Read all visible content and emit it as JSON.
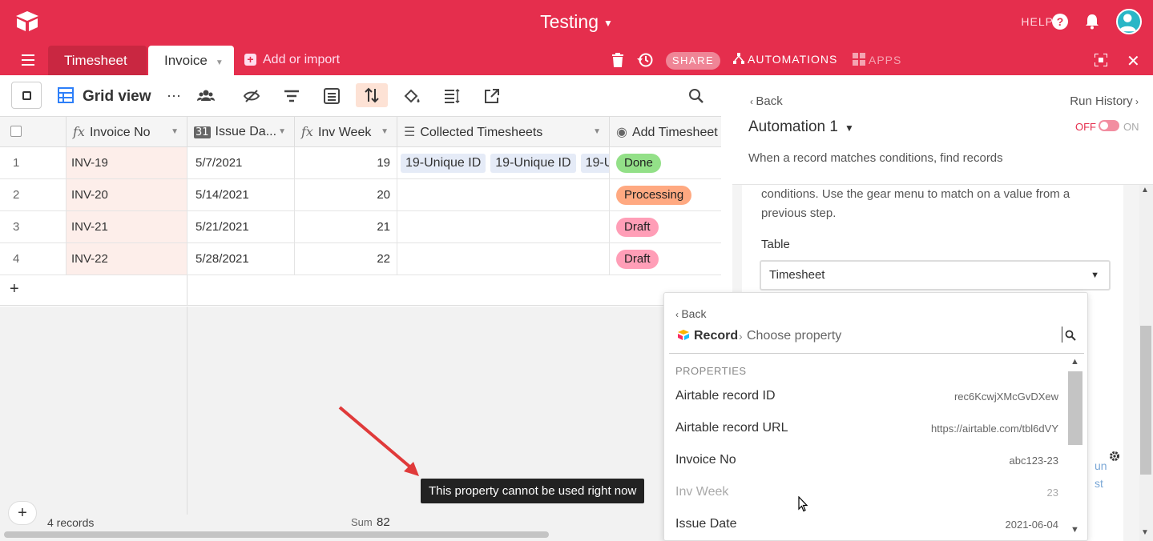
{
  "app": {
    "base_title": "Testing",
    "help_label": "HELP"
  },
  "tabs": [
    {
      "label": "Timesheet"
    },
    {
      "label": "Invoice"
    }
  ],
  "topbar": {
    "add_import": "Add or import",
    "share": "SHARE",
    "automations": "AUTOMATIONS",
    "apps": "APPS"
  },
  "toolbar": {
    "view_name": "Grid view"
  },
  "grid": {
    "columns": [
      {
        "label": "Invoice No",
        "icon": "formula-icon"
      },
      {
        "label": "Issue Da...",
        "icon": "calendar-icon"
      },
      {
        "label": "Inv Week",
        "icon": "formula-icon"
      },
      {
        "label": "Collected Timesheets",
        "icon": "link-icon"
      },
      {
        "label": "Add Timesheet",
        "icon": "select-icon"
      }
    ],
    "rows": [
      {
        "num": "1",
        "invoice": "INV-19",
        "date": "5/7/2021",
        "week": "19",
        "chips": [
          "19-Unique ID",
          "19-Unique ID",
          "19-U"
        ],
        "status": "Done",
        "status_color": "#93e088"
      },
      {
        "num": "2",
        "invoice": "INV-20",
        "date": "5/14/2021",
        "week": "20",
        "chips": [],
        "status": "Processing",
        "status_color": "#ffa981"
      },
      {
        "num": "3",
        "invoice": "INV-21",
        "date": "5/21/2021",
        "week": "21",
        "chips": [],
        "status": "Draft",
        "status_color": "#ff9eb7"
      },
      {
        "num": "4",
        "invoice": "INV-22",
        "date": "5/28/2021",
        "week": "22",
        "chips": [],
        "status": "Draft",
        "status_color": "#ff9eb7"
      }
    ],
    "add_row": "+",
    "records_count": "4 records",
    "sum_label": "Sum",
    "sum_value": "82"
  },
  "tooltip": "This property cannot be used right now",
  "panel": {
    "back": "Back",
    "run_history": "Run History",
    "automation_name": "Automation 1",
    "toggle_off": "OFF",
    "toggle_on": "ON",
    "trigger_desc": "When a record matches conditions, find records",
    "cond_text": "conditions. Use the gear menu to match on a value from a previous step.",
    "table_label": "Table",
    "table_value": "Timesheet",
    "partial_link_1": "un",
    "partial_link_2": "st"
  },
  "popup": {
    "back": "Back",
    "crumb_record": "Record",
    "crumb_sep": "›",
    "crumb_choose": "Choose property",
    "section": "PROPERTIES",
    "properties": [
      {
        "name": "Airtable record ID",
        "value": "rec6KcwjXMcGvDXew",
        "disabled": false
      },
      {
        "name": "Airtable record URL",
        "value": "https://airtable.com/tbl6dVY",
        "disabled": false
      },
      {
        "name": "Invoice No",
        "value": "abc123-23",
        "disabled": false
      },
      {
        "name": "Inv Week",
        "value": "23",
        "disabled": true
      },
      {
        "name": "Issue Date",
        "value": "2021-06-04",
        "disabled": false
      }
    ]
  }
}
